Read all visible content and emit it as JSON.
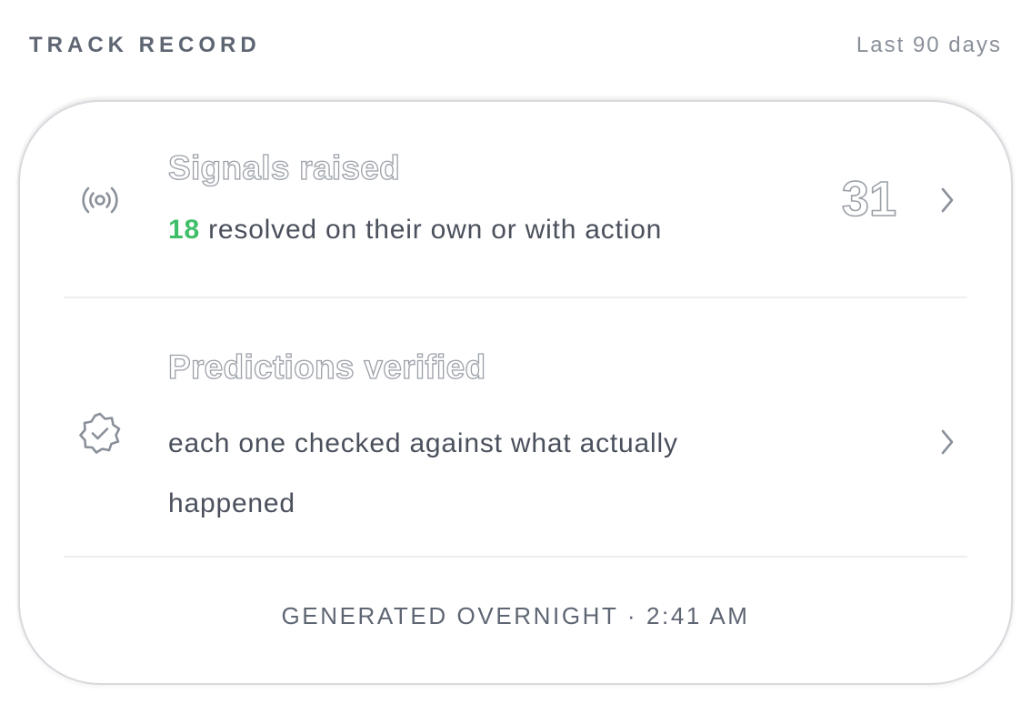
{
  "header": {
    "title": "TRACK RECORD",
    "range": "Last 90 days"
  },
  "signals": {
    "icon": "broadcast-icon",
    "title": "Signals raised",
    "resolved_count": "18",
    "subtitle": " resolved on their own or with action",
    "count": "31",
    "chevron_icon": "chevron-right-icon"
  },
  "predictions": {
    "icon": "verified-badge-icon",
    "title": "Predictions verified",
    "subtitle_line1": "each one checked against what actually",
    "subtitle_line2": "happened",
    "chevron_icon": "chevron-right-icon"
  },
  "footer": {
    "text": "GENERATED OVERNIGHT · 2:41 AM"
  },
  "colors": {
    "highlight": "#3fbf6a",
    "text": "#4a505c",
    "muted": "#8a909a",
    "outline": "#9ba0a8"
  }
}
